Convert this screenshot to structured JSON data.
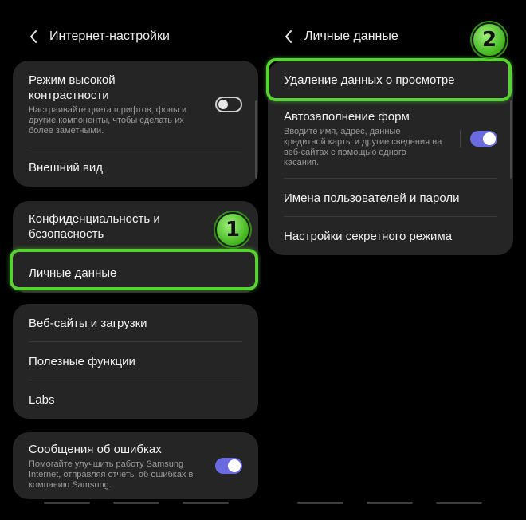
{
  "left": {
    "title": "Интернет-настройки",
    "card1": {
      "contrast": {
        "title": "Режим высокой контрастности",
        "desc": "Настраивайте цвета шрифтов, фоны и другие компоненты, чтобы сделать их более заметными."
      },
      "appearance": "Внешний вид"
    },
    "card2": {
      "privacy": "Конфиденциальность и безопасность",
      "personal": "Личные данные"
    },
    "card3": {
      "sites": "Веб-сайты и загрузки",
      "features": "Полезные функции",
      "labs": "Labs"
    },
    "card4": {
      "errors": {
        "title": "Сообщения об ошибках",
        "desc": "Помогайте улучшить работу Samsung Internet, отправляя отчеты об ошибках в компанию Samsung."
      }
    },
    "badge": "1"
  },
  "right": {
    "title": "Личные данные",
    "items": {
      "delete": "Удаление данных о просмотре",
      "autofill": {
        "title": "Автозаполнение форм",
        "desc": "Вводите имя, адрес, данные кредитной карты и другие сведения на веб-сайтах с помощью одного касания."
      },
      "passwords": "Имена пользователей и пароли",
      "secret": "Настройки секретного режима"
    },
    "badge": "2"
  },
  "colors": {
    "highlight": "#57d233",
    "toggle_on": "#6b6ae0",
    "card_bg": "#252525"
  }
}
